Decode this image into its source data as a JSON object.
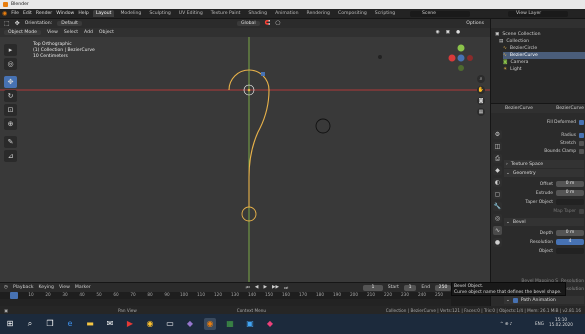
{
  "window": {
    "title": "Blender"
  },
  "menubar": {
    "items": [
      "File",
      "Edit",
      "Render",
      "Window",
      "Help"
    ],
    "workspaces": [
      "Layout",
      "Modeling",
      "Sculpting",
      "UV Editing",
      "Texture Paint",
      "Shading",
      "Animation",
      "Rendering",
      "Compositing",
      "Scripting"
    ],
    "active_workspace": "Layout",
    "scene_label": "Scene",
    "view_layer_label": "View Layer"
  },
  "tool_options": {
    "orientation_label": "Orientation:",
    "orientation_value": "Default",
    "options_label": "Options"
  },
  "viewport_header": {
    "mode": "Object Mode",
    "menus": [
      "View",
      "Select",
      "Add",
      "Object"
    ],
    "transform": "Global"
  },
  "viewport_overlay": {
    "line1": "Top Orthographic",
    "line2": "(1) Collection | BezierCurve",
    "line3": "10 Centimeters"
  },
  "gizmo": {
    "x": "X",
    "y": "Y",
    "z": "Z"
  },
  "outliner": {
    "root": "Scene Collection",
    "items": [
      {
        "label": "Collection",
        "selected": false,
        "indent": 1
      },
      {
        "label": "BezierCircle",
        "selected": false,
        "indent": 2
      },
      {
        "label": "BezierCurve",
        "selected": true,
        "indent": 2
      },
      {
        "label": "Camera",
        "selected": false,
        "indent": 2
      },
      {
        "label": "Light",
        "selected": false,
        "indent": 2
      }
    ]
  },
  "properties": {
    "object_name": "BezierCurve",
    "data_name": "BezierCurve",
    "fill_deformed": "Fill Deformed",
    "radius_label": "Radius",
    "stretch_label": "Stretch",
    "bounds_clamp_label": "Bounds Clamp",
    "texture_space_label": "Texture Space",
    "geometry_label": "Geometry",
    "offset_label": "Offset",
    "offset_value": "0 m",
    "extrude_label": "Extrude",
    "extrude_value": "0 m",
    "taper_label": "Taper Object",
    "map_taper_label": "Map Taper",
    "bevel_label": "Bevel",
    "depth_label": "Depth",
    "depth_value": "0 m",
    "resolution_label": "Resolution",
    "resolution_value": "4",
    "object_label": "Object",
    "bevel_mapping_label": "Bevel Mapping S",
    "start_mapping": "Resolution",
    "end_label": "End",
    "end_mapping": "Resolution",
    "path_animation_label": "Path Animation"
  },
  "tooltip": {
    "line1": "Bevel Object.",
    "line2": "Curve object name that defines the bevel shape."
  },
  "timeline": {
    "menus": [
      "Playback",
      "Keying",
      "View",
      "Marker"
    ],
    "current_frame": "1",
    "start_label": "Start",
    "start_value": "1",
    "end_label": "End",
    "end_value": "250",
    "ruler": [
      "0",
      "10",
      "20",
      "30",
      "40",
      "50",
      "60",
      "70",
      "80",
      "90",
      "100",
      "110",
      "120",
      "130",
      "140",
      "150",
      "160",
      "170",
      "180",
      "190",
      "200",
      "210",
      "220",
      "230",
      "240",
      "250"
    ]
  },
  "statusbar": {
    "left": "Pan View",
    "middle": "Context Menu",
    "right": "Collection | BezierCurve | Verts:121 | Faces:0 | Tris:0 | Objects:1/4 | Mem: 26.1 MiB | v2.81.16"
  },
  "taskbar": {
    "time": "15:10",
    "date": "15.02.2020",
    "language": "ENG"
  },
  "colors": {
    "selection_blue": "#4772b3",
    "curve_yellow": "#e8b24a",
    "axis_red": "#d83a3a",
    "axis_green": "#8bc34a",
    "brand_orange": "#e87d0d"
  }
}
